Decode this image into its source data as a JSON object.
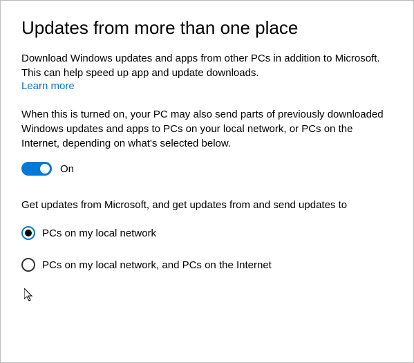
{
  "title": "Updates from more than one place",
  "intro": "Download Windows updates and apps from other PCs in addition to Microsoft. This can help speed up app and update downloads.",
  "learnMore": "Learn more",
  "description": "When this is turned on, your PC may also send parts of previously downloaded Windows updates and apps to PCs on your local network, or PCs on the Internet, depending on what's selected below.",
  "toggle": {
    "state": "on",
    "label": "On"
  },
  "radioIntro": "Get updates from Microsoft, and get updates from and send updates to",
  "radios": {
    "option1": "PCs on my local network",
    "option2": "PCs on my local network, and PCs on the Internet",
    "selected": "option1"
  }
}
